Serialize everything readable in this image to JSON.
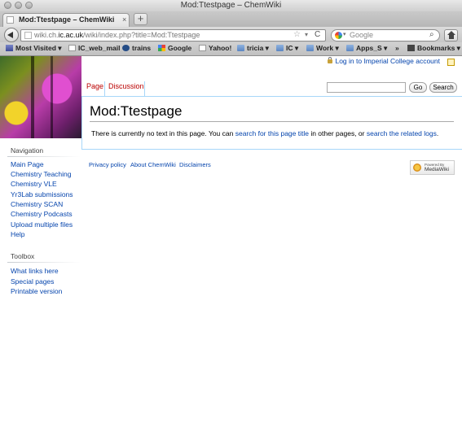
{
  "window": {
    "title": "Mod:Ttestpage – ChemWiki"
  },
  "tab": {
    "label": "Mod:Ttestpage – ChemWiki",
    "close": "×",
    "new_tab": "+"
  },
  "urlbar": {
    "prefix": "wiki.ch.",
    "host": "ic.ac.uk",
    "path": "/wiki/index.php?title=Mod:Ttestpage",
    "star": "☆",
    "drop": "▾",
    "reload": "C"
  },
  "searchbar": {
    "placeholder": "Google",
    "drop": "▾",
    "icon": "⌕"
  },
  "bookmarks": {
    "items": [
      {
        "label": "Most Visited ▾",
        "icon": "most-visited-icon"
      },
      {
        "label": "IC_web_mail",
        "icon": "page-icon"
      },
      {
        "label": "trains",
        "icon": "trains-icon"
      },
      {
        "label": "Google",
        "icon": "google-icon"
      },
      {
        "label": "Yahoo!",
        "icon": "page-icon"
      },
      {
        "label": "tricia ▾",
        "icon": "folder-icon"
      },
      {
        "label": "IC ▾",
        "icon": "folder-icon"
      },
      {
        "label": "Work ▾",
        "icon": "folder-icon"
      },
      {
        "label": "Apps_S ▾",
        "icon": "folder-icon"
      }
    ],
    "overflow": "»",
    "menu_label": "Bookmarks ▾"
  },
  "personal": {
    "login": "Log in to Imperial College account"
  },
  "page_tabs": {
    "page": "Page",
    "discussion": "Discussion"
  },
  "search": {
    "go": "Go",
    "search": "Search",
    "value": ""
  },
  "content": {
    "title": "Mod:Ttestpage",
    "text_before": "There is currently no text in this page. You can ",
    "link1": "search for this page title",
    "text_middle": " in other pages, or ",
    "link2": "search the related logs",
    "text_after": "."
  },
  "footer": {
    "privacy": "Privacy policy",
    "about": "About ChemWiki",
    "disclaimers": "Disclaimers",
    "powered_small": "Powered By",
    "powered_big": "MediaWiki"
  },
  "navigation": {
    "heading": "Navigation",
    "items": [
      "Main Page",
      "Chemistry Teaching",
      "Chemistry VLE",
      "Yr3Lab submissions",
      "Chemistry SCAN",
      "Chemistry Podcasts",
      "Upload multiple files",
      "Help"
    ]
  },
  "toolbox": {
    "heading": "Toolbox",
    "items": [
      "What links here",
      "Special pages",
      "Printable version"
    ]
  }
}
